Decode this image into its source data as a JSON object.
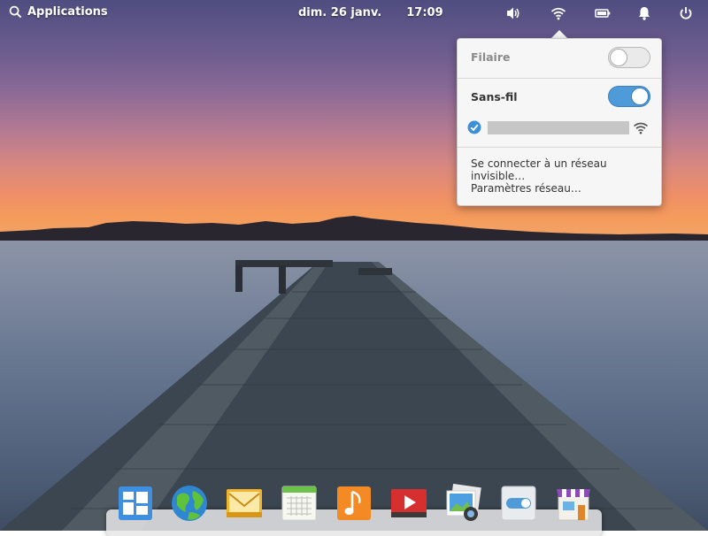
{
  "panel": {
    "applications_label": "Applications",
    "date": "dim. 26 janv.",
    "time": "17:09",
    "indicators": [
      "volume-icon",
      "wifi-icon",
      "battery-icon",
      "notifications-bell-icon",
      "power-icon"
    ]
  },
  "network_popover": {
    "wired": {
      "label": "Filaire",
      "enabled": false
    },
    "wireless": {
      "label": "Sans-fil",
      "enabled": true
    },
    "connected_network": {
      "ssid": "",
      "selected": true
    },
    "links": [
      {
        "label": "Se connecter à un réseau invisible…"
      },
      {
        "label": "Paramètres réseau…"
      }
    ]
  },
  "dock": {
    "items": [
      {
        "icon": "multitasking-view-icon"
      },
      {
        "icon": "web-browser-icon"
      },
      {
        "icon": "mail-icon"
      },
      {
        "icon": "calendar-icon"
      },
      {
        "icon": "music-icon"
      },
      {
        "icon": "videos-icon"
      },
      {
        "icon": "photos-icon"
      },
      {
        "icon": "system-settings-icon"
      },
      {
        "icon": "appcenter-icon"
      }
    ]
  },
  "colors": {
    "accent": "#4f9bd9",
    "panel_text": "#ffffff",
    "popover_bg": "#f6f6f6"
  }
}
